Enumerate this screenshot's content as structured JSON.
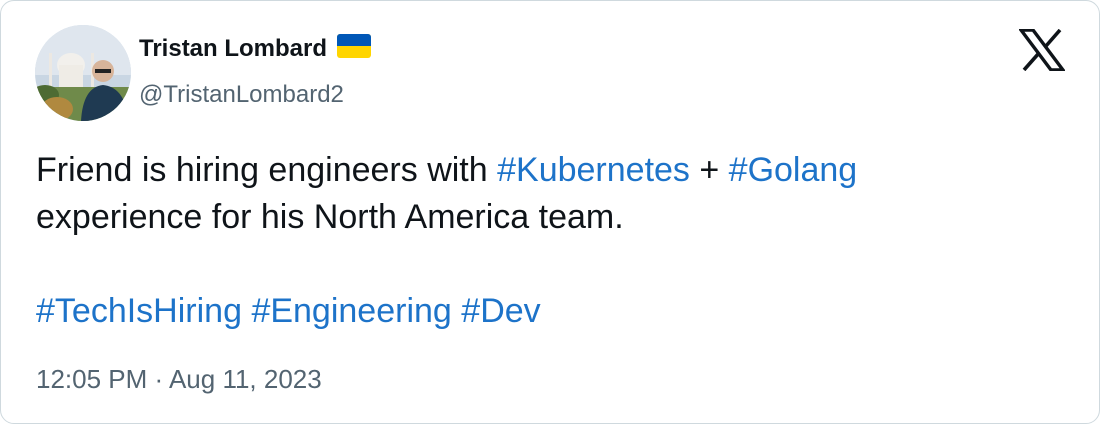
{
  "author": {
    "display_name": "Tristan Lombard",
    "handle": "@TristanLombard2",
    "flag_icon": "ukraine-flag-icon",
    "avatar_icon": "profile-photo"
  },
  "platform": {
    "logo_icon": "x-logo-icon"
  },
  "tweet": {
    "text_part1": "Friend is hiring engineers with ",
    "tag_kubernetes": "#Kubernetes",
    "text_plus": " + ",
    "tag_golang": "#Golang",
    "text_part2": "experience for his North America team.",
    "tag_techishiring": "#TechIsHiring",
    "tag_engineering": "#Engineering",
    "tag_dev": "#Dev"
  },
  "timestamp": "12:05 PM · Aug 11, 2023",
  "colors": {
    "hashtag": "#1d73c9",
    "text": "#0f1419",
    "secondary": "#536471",
    "border": "#cfd9de"
  }
}
